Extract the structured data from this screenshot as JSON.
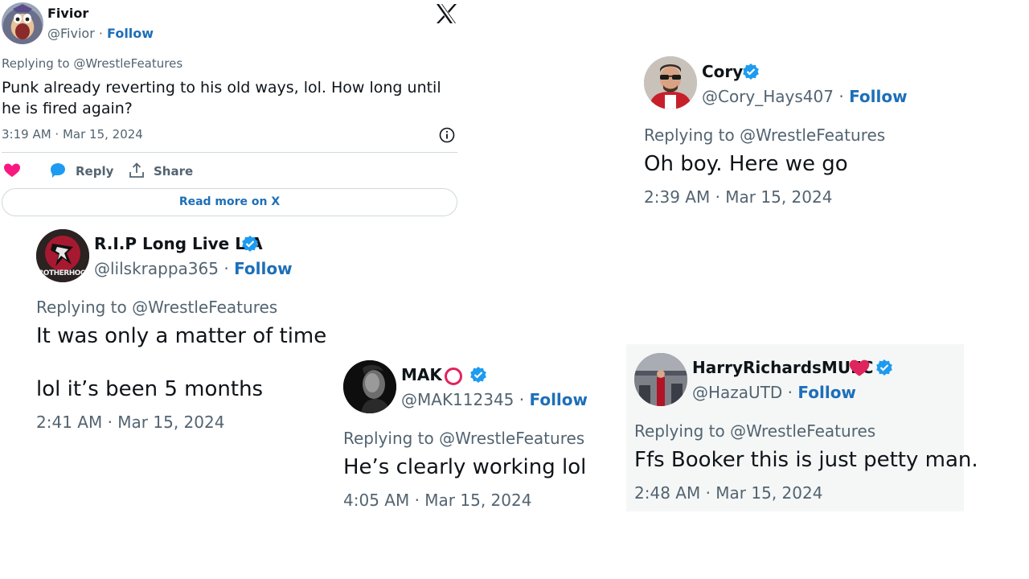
{
  "fivior": {
    "name": "Fivior",
    "handle": "@Fivior",
    "sep": "·",
    "follow": "Follow",
    "replying": "Replying to @WrestleFeatures",
    "text_line1": "Punk already reverting to his old ways, lol.  How long until",
    "text_line2": "he is fired again?",
    "timestamp": "3:19 AM · Mar 15, 2024",
    "reply_label": "Reply",
    "share_label": "Share",
    "read_more": "Read more on X"
  },
  "cory": {
    "name": "Cory",
    "handle": "@Cory_Hays407",
    "sep": "·",
    "follow": "Follow",
    "replying": "Replying to @WrestleFeatures",
    "text": "Oh boy. Here we go",
    "timestamp": "2:39 AM · Mar 15, 2024"
  },
  "rip": {
    "name": "R.I.P Long Live L'A",
    "handle": "@lilskrappa365",
    "sep": "·",
    "follow": "Follow",
    "replying": "Replying to @WrestleFeatures",
    "text_line1": "It was only a matter of time",
    "text_line2": "lol it’s been 5 months",
    "timestamp": "2:41 AM · Mar 15, 2024",
    "avatar_text": "BROTHERHOO"
  },
  "mak": {
    "name": "MAK",
    "handle": "@MAK112345",
    "sep": "·",
    "follow": "Follow",
    "replying": "Replying to @WrestleFeatures",
    "text": "He’s clearly working lol",
    "timestamp": "4:05 AM · Mar 15, 2024"
  },
  "harry": {
    "name": "HarryRichardsMUFC",
    "handle": "@HazaUTD",
    "sep": "·",
    "follow": "Follow",
    "replying": "Replying to @WrestleFeatures",
    "text": "Ffs Booker this is just petty man.",
    "timestamp": "2:48 AM · Mar 15, 2024"
  },
  "colors": {
    "verified": "#1d9bf0",
    "follow": "#1d6fb8",
    "muted": "#536471",
    "heart": "#f91880",
    "red_heart": "#e0245e"
  },
  "icons": [
    "x-logo-icon",
    "info-icon",
    "heart-icon",
    "reply-bubble-icon",
    "share-icon",
    "verified-badge-icon",
    "red-circle-icon",
    "red-heart-icon"
  ]
}
